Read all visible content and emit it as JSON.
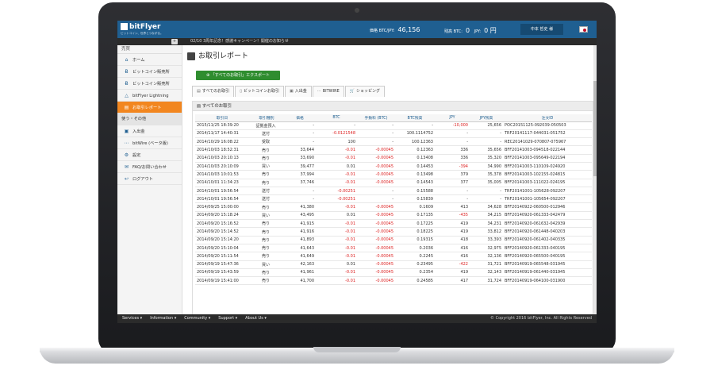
{
  "brand": {
    "name": "bitFlyer",
    "tagline": "ビットコイン、世界とつながる。"
  },
  "header": {
    "price_label": "価格 BTC/JPY:",
    "price_value": "46,156",
    "balance_label": "残高 BTC:",
    "balance_btc": "0",
    "balance_jpy_label": "JPY:",
    "balance_jpy": "0 円",
    "user": "中本 哲史 様"
  },
  "ticker": "02/10 3周年記念！感謝キャンペーン！開催のお知らせ",
  "sidebar": {
    "head": "売買",
    "items": [
      {
        "icon": "home-icon",
        "glyph": "⌂",
        "label": "ホーム"
      },
      {
        "icon": "bitcoin-buy-icon",
        "glyph": "Ƀ",
        "label": "ビットコイン販売所"
      },
      {
        "icon": "bitcoin-shop-icon",
        "glyph": "Ƀ",
        "label": "ビットコイン販売所"
      },
      {
        "icon": "lightning-icon",
        "glyph": "△",
        "label": "bitFlyer Lightning"
      },
      {
        "icon": "report-icon",
        "glyph": "▤",
        "label": "お取引レポート",
        "active": true
      }
    ],
    "section2": "使う・その他",
    "items2": [
      {
        "icon": "deposit-icon",
        "glyph": "▣",
        "label": "入出金"
      },
      {
        "icon": "bitwire-icon",
        "glyph": "⋯",
        "label": "bitWire (ベータ版)"
      },
      {
        "icon": "gear-icon",
        "glyph": "⚙",
        "label": "設定"
      },
      {
        "icon": "faq-icon",
        "glyph": "✉",
        "label": "FAQ/お問い合わせ"
      },
      {
        "icon": "logout-icon",
        "glyph": "↩",
        "label": "ログアウト"
      }
    ]
  },
  "main": {
    "title": "お取引レポート",
    "export_label": "「すべてのお取引」エクスポート",
    "tabs": [
      {
        "icon": "list-icon",
        "glyph": "▤",
        "label": "すべてのお取引"
      },
      {
        "icon": "bitcoin-icon",
        "glyph": "▯",
        "label": "ビットコインお取引"
      },
      {
        "icon": "deposit-icon",
        "glyph": "▣",
        "label": "入出金"
      },
      {
        "icon": "bitwire-icon",
        "glyph": "⋯",
        "label": "BITWIRE"
      },
      {
        "icon": "cart-icon",
        "glyph": "🛒",
        "label": "ショッピング"
      }
    ],
    "box_title": "すべてのお取引",
    "columns": [
      "取引日",
      "取引種別",
      "価格",
      "BTC",
      "手数料 (BTC)",
      "BTC残高",
      "JPY",
      "JPY残高",
      "注文ID"
    ],
    "rows": [
      [
        "2015/11/25 18:39:20",
        "証拠金預入",
        "-",
        "-",
        "-",
        "-",
        "-10,000",
        "25,656",
        "POC20151125-092039-050503"
      ],
      [
        "2014/11/17 14:40:31",
        "送付",
        "-",
        "-0.0121548",
        "-",
        "100.1114752",
        "-",
        "-",
        "TRF20141117-044031-051752"
      ],
      [
        "2014/10/29 16:08:22",
        "受取",
        "-",
        "100",
        "-",
        "100.12363",
        "-",
        "-",
        "REC20141029-070807-075967"
      ],
      [
        "2014/10/03 18:52:31",
        "売り",
        "33,644",
        "-0.01",
        "-0.00045",
        "0.12363",
        "336",
        "35,656",
        "BFF20141003-094518-022144"
      ],
      [
        "2014/10/03 20:10:13",
        "売り",
        "33,690",
        "-0.01",
        "-0.00045",
        "0.13408",
        "336",
        "35,320",
        "BFF20141003-095649-022194"
      ],
      [
        "2014/10/03 20:10:09",
        "買い",
        "39,477",
        "0.01",
        "-0.00045",
        "0.14453",
        "-394",
        "34,990",
        "BFF20141003-110109-024920"
      ],
      [
        "2014/10/03 10:01:53",
        "売り",
        "37,994",
        "-0.01",
        "-0.00045",
        "0.13498",
        "379",
        "35,378",
        "BFF20141003-102155-024815"
      ],
      [
        "2014/10/01 11:34:23",
        "売り",
        "37,746",
        "-0.01",
        "-0.00045",
        "0.14543",
        "377",
        "35,005",
        "BFF20141003-111022-024195"
      ],
      [
        "2014/10/01 19:56:54",
        "送付",
        "-",
        "-0.00251",
        "-",
        "0.15588",
        "-",
        "-",
        "TRF20141001-105628-092207"
      ],
      [
        "2014/10/01 19:56:54",
        "送付",
        "-",
        "-0.00251",
        "-",
        "0.15839",
        "-",
        "-",
        "TRF20141001-105654-092207"
      ],
      [
        "2014/09/25 15:00:00",
        "売り",
        "41,380",
        "-0.01",
        "-0.00045",
        "0.1609",
        "413",
        "34,628",
        "BFF20140922-060500-012946"
      ],
      [
        "2014/09/20 15:18:24",
        "買い",
        "43,495",
        "0.01",
        "-0.00045",
        "0.17135",
        "-435",
        "34,215",
        "BFF20140920-061333-042479"
      ],
      [
        "2014/09/20 15:16:52",
        "売り",
        "41,915",
        "-0.01",
        "-0.00045",
        "0.17225",
        "419",
        "34,231",
        "BFF20140920-061632-042939"
      ],
      [
        "2014/09/20 15:14:52",
        "売り",
        "41,916",
        "-0.01",
        "-0.00045",
        "0.18225",
        "419",
        "33,812",
        "BFF20140920-061448-040203"
      ],
      [
        "2014/09/20 15:14:20",
        "売り",
        "41,893",
        "-0.01",
        "-0.00045",
        "0.19315",
        "418",
        "33,393",
        "BFF20140920-061402-040335"
      ],
      [
        "2014/09/20 15:10:04",
        "売り",
        "41,643",
        "-0.01",
        "-0.00045",
        "0.2036",
        "416",
        "32,975",
        "BFF20140920-061333-040195"
      ],
      [
        "2014/09/20 15:11:54",
        "売り",
        "41,649",
        "-0.01",
        "-0.00045",
        "0.2245",
        "416",
        "32,136",
        "BFF20140920-065500-040195"
      ],
      [
        "2014/09/19 15:47:36",
        "買い",
        "42,163",
        "0.01",
        "-0.00045",
        "0.23495",
        "-422",
        "31,721",
        "BFF20140919-065548-031945"
      ],
      [
        "2014/09/19 15:43:59",
        "売り",
        "41,961",
        "-0.01",
        "-0.00045",
        "0.2354",
        "419",
        "32,143",
        "BFF20140919-061440-031945"
      ],
      [
        "2014/09/19 15:41:00",
        "売り",
        "41,700",
        "-0.01",
        "-0.00045",
        "0.24585",
        "417",
        "31,724",
        "BFF20140919-064100-031900"
      ]
    ]
  },
  "footer": {
    "nav": [
      "Services ▾",
      "Information ▾",
      "Community ▾",
      "Support ▾",
      "About Us ▾"
    ],
    "copyright": "© Copyright 2016 bitFlyer, Inc. All Rights Reserved"
  },
  "colors": {
    "header": "#1f5f91",
    "active": "#f2861f",
    "export": "#2f8d2f",
    "negative": "#dd2222"
  }
}
